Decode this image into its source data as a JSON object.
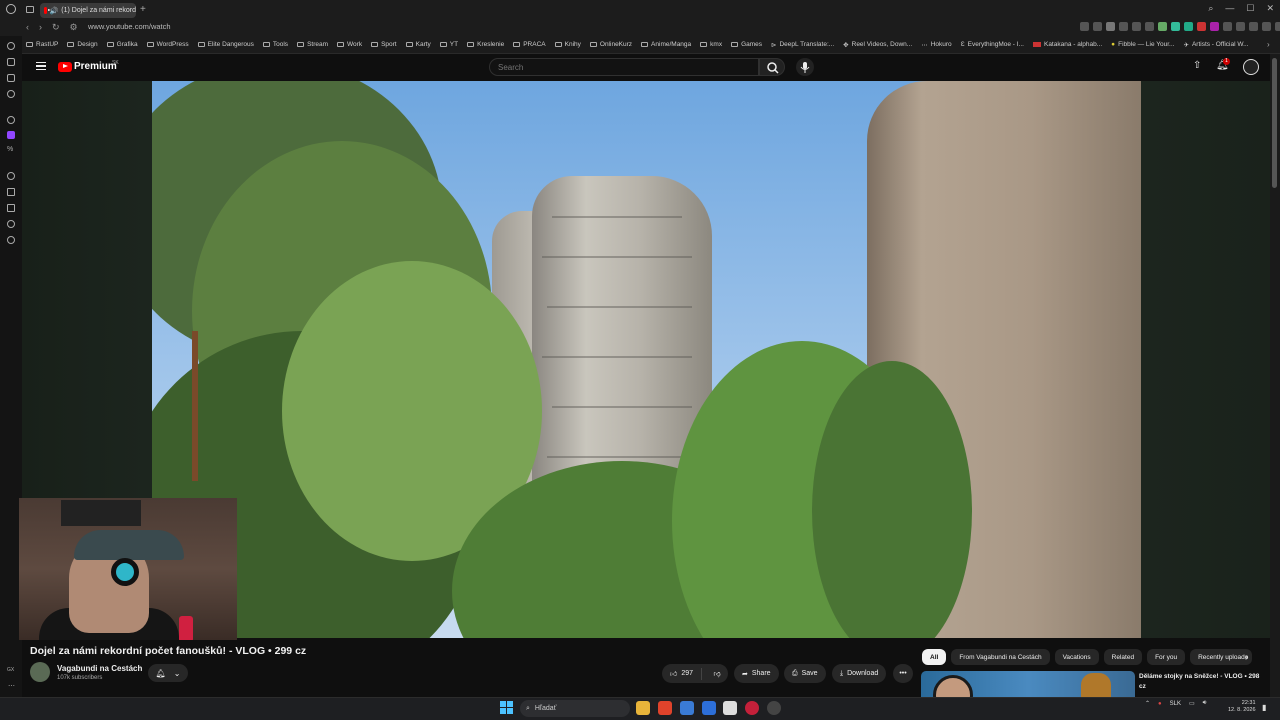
{
  "browser": {
    "tab_title": "(1) Dojel za námi rekord",
    "url": "www.youtube.com/watch",
    "bookmarks": [
      "RastUP",
      "Design",
      "Grafika",
      "WordPress",
      "Elite Dangerous",
      "Tools",
      "Stream",
      "Work",
      "Sport",
      "Karty",
      "YT",
      "Kreslenie",
      "PRACA",
      "Knihy",
      "OnlineKurz",
      "Anime/Manga",
      "kmx",
      "Games",
      "DeepL Translate:...",
      "Reel Videos, Down...",
      "Hokuro",
      "EverythingMoe - I...",
      "Katakana - alphab...",
      "Fibble — Lie Your...",
      "Artists - Official W..."
    ]
  },
  "youtube": {
    "logo_text": "Premium",
    "country_code": "SK",
    "search_placeholder": "Search",
    "notification_count": "1",
    "video": {
      "title": "Dojel za námi rekordní počet fanoušků! - VLOG • 299 cz",
      "channel_name": "Vagabundi na Cestách",
      "subscribers": "107k subscribers",
      "likes": "297",
      "share_label": "Share",
      "save_label": "Save",
      "download_label": "Download",
      "more_label": "•••"
    },
    "chips": [
      "All",
      "From Vagabundi na Cestách",
      "Vacations",
      "Related",
      "For you",
      "Recently uploade"
    ],
    "recommendation": {
      "title": "Děláme stojky na Sněžce! - VLOG • 298 cz"
    }
  },
  "sidebar": {
    "gx_label": "GX"
  },
  "taskbar": {
    "search_label": "Hľadať",
    "language": "SLK",
    "time": "22:31",
    "date": "12. 8. 2026"
  }
}
